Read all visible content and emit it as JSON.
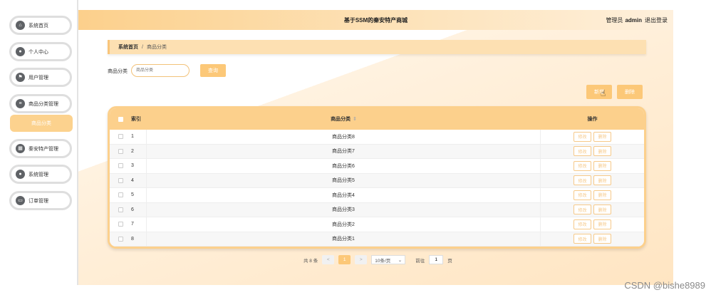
{
  "sidebar": {
    "items": [
      {
        "label": "系统首页",
        "icon": "home-icon"
      },
      {
        "label": "个人中心",
        "icon": "user-icon"
      },
      {
        "label": "用户管理",
        "icon": "flag-icon"
      },
      {
        "label": "商品分类管理",
        "icon": "list-icon"
      },
      {
        "label": "秦安特产管理",
        "icon": "grid-icon"
      },
      {
        "label": "系统管理",
        "icon": "person-icon"
      },
      {
        "label": "订单管理",
        "icon": "order-icon"
      }
    ],
    "active_sub": "商品分类"
  },
  "header": {
    "title": "基于SSM的秦安特产商城",
    "role": "管理员",
    "username": "admin",
    "logout": "退出登录"
  },
  "breadcrumb": {
    "home": "系统首页",
    "sep": "/",
    "current": "商品分类"
  },
  "search": {
    "label": "商品分类",
    "placeholder": "商品分类",
    "button": "查询"
  },
  "actions": {
    "add": "新增",
    "delete": "删除"
  },
  "table": {
    "headers": {
      "index": "索引",
      "name": "商品分类",
      "ops": "操作"
    },
    "rows": [
      {
        "index": "1",
        "name": "商品分类8"
      },
      {
        "index": "2",
        "name": "商品分类7"
      },
      {
        "index": "3",
        "name": "商品分类6"
      },
      {
        "index": "4",
        "name": "商品分类5"
      },
      {
        "index": "5",
        "name": "商品分类4"
      },
      {
        "index": "6",
        "name": "商品分类3"
      },
      {
        "index": "7",
        "name": "商品分类2"
      },
      {
        "index": "8",
        "name": "商品分类1"
      }
    ],
    "edit_label": "修改",
    "delete_label": "删除"
  },
  "pager": {
    "total": "共 8 条",
    "prev": "<",
    "page": "1",
    "next": ">",
    "size": "10条/页",
    "goto": "前往",
    "goto_value": "1",
    "page_unit": "页"
  },
  "watermark": "CSDN @bishe8989",
  "colors": {
    "accent": "#fcc878",
    "header": "#fcd08c"
  }
}
